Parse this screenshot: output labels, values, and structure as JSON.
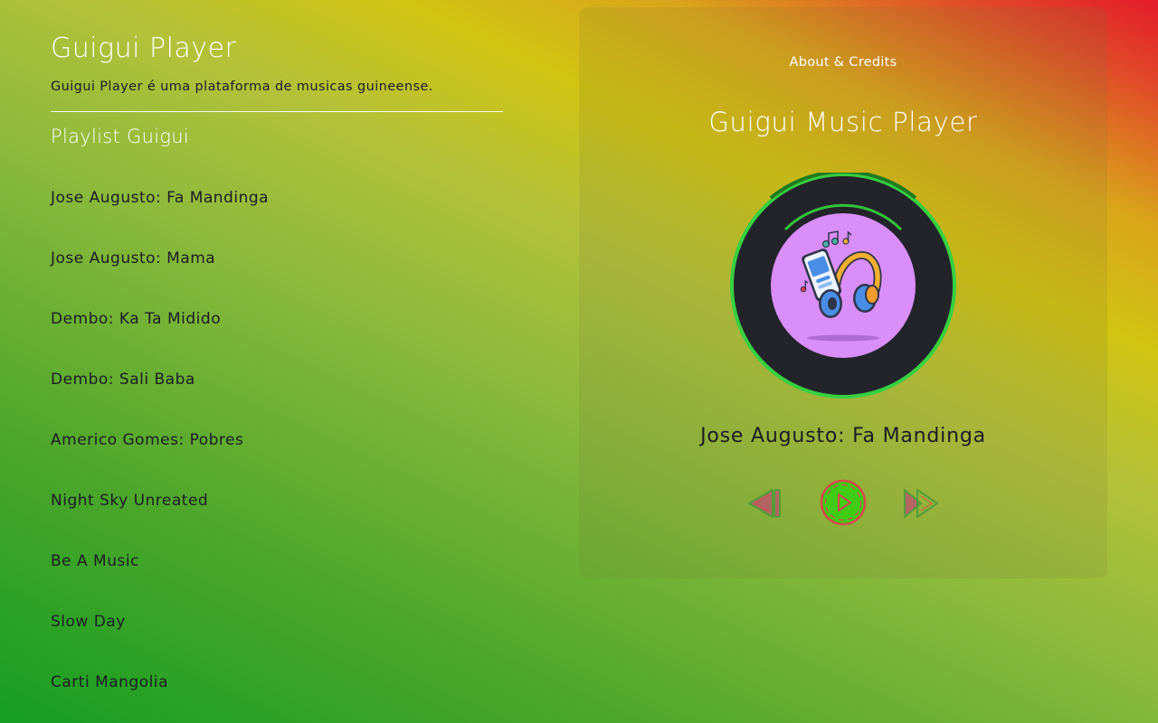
{
  "sidebar": {
    "title": "Guigui Player",
    "description": "Guigui Player é uma plataforma de musicas guineense.",
    "playlist_title": "Playlist Guigui",
    "tracks": [
      "Jose Augusto: Fa Mandinga",
      "Jose Augusto: Mama",
      "Dembo: Ka Ta Midido",
      "Dembo: Sali Baba",
      "Americo Gomes: Pobres",
      "Night Sky Unreated",
      "Be A Music",
      "Slow Day",
      "Carti Mangolia"
    ]
  },
  "player": {
    "about_link": "About & Credits",
    "title": "Guigui Music Player",
    "now_playing": "Jose Augusto: Fa Mandinga",
    "artwork_icon": "phone-headphones-music-icon",
    "controls": {
      "prev_icon": "skip-back-icon",
      "play_icon": "play-icon",
      "next_icon": "fast-forward-icon"
    }
  },
  "colors": {
    "disc_ring": "#37d042",
    "disc_body": "#23232a",
    "disc_label": "#d98ef9",
    "play_button": "#3fcb16",
    "control_outline": "#d9464a"
  }
}
